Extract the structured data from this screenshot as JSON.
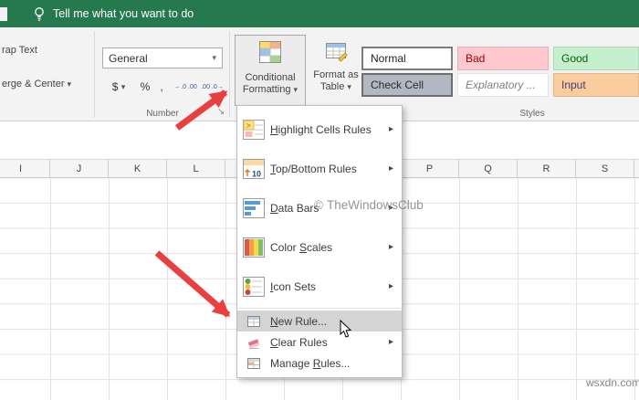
{
  "colors": {
    "brand-green": "#26794f",
    "bad-bg": "#ffc7ce",
    "bad-text": "#9c0006",
    "good-bg": "#c6efce",
    "good-text": "#006100",
    "input-bg": "#fbcd9e",
    "input-text": "#3f3f76",
    "check-bg": "#b2b8c2",
    "menu-highlight": "#d4d4d4",
    "arrow-red": "#e84040",
    "grid-line": "#e2e2e2"
  },
  "topbar": {
    "search_hint": "Tell me what you want to do"
  },
  "ribbon": {
    "wrap_text": "rap Text",
    "merge_center": "erge & Center",
    "number_format_value": "General",
    "currency": "$",
    "percent": "%",
    "comma": ",",
    "increase_decimal": "←.0 .00",
    "decrease_decimal": ".00 .0→",
    "number_group_label": "Number",
    "conditional_formatting_label": "Conditional Formatting",
    "format_as_table_label": "Format as Table",
    "styles_group_label": "Styles",
    "styles": [
      {
        "label": "Normal"
      },
      {
        "label": "Bad"
      },
      {
        "label": "Good"
      },
      {
        "label": "Check Cell"
      },
      {
        "label": "Explanatory ..."
      },
      {
        "label": "Input"
      }
    ]
  },
  "icons": {
    "caret_down": "▾",
    "submenu_arrow": "▸",
    "dialog_launcher": "↘"
  },
  "sheet": {
    "columns": [
      "I",
      "J",
      "K",
      "L",
      "",
      "",
      "",
      "P",
      "Q",
      "R",
      "S",
      ""
    ]
  },
  "menu": {
    "items": [
      {
        "pre": "",
        "key": "H",
        "post": "ighlight Cells Rules",
        "icon": "highlight-cells-rules-icon",
        "submenu": true,
        "highlighted": false
      },
      {
        "pre": "",
        "key": "T",
        "post": "op/Bottom Rules",
        "icon": "top-bottom-rules-icon",
        "submenu": true,
        "highlighted": false
      },
      {
        "pre": "",
        "key": "D",
        "post": "ata Bars",
        "icon": "data-bars-icon",
        "submenu": true,
        "highlighted": false
      },
      {
        "pre": "Color ",
        "key": "S",
        "post": "cales",
        "icon": "color-scales-icon",
        "submenu": true,
        "highlighted": false
      },
      {
        "pre": "",
        "key": "I",
        "post": "con Sets",
        "icon": "icon-sets-icon",
        "submenu": true,
        "highlighted": false
      },
      {
        "pre": "",
        "key": "N",
        "post": "ew Rule...",
        "icon": "new-rule-icon",
        "submenu": false,
        "highlighted": true
      },
      {
        "pre": "",
        "key": "C",
        "post": "lear Rules",
        "icon": "clear-rules-icon",
        "submenu": true,
        "highlighted": false
      },
      {
        "pre": "Manage ",
        "key": "R",
        "post": "ules...",
        "icon": "manage-rules-icon",
        "submenu": false,
        "highlighted": false
      }
    ]
  },
  "watermark": {
    "symbol": "©",
    "center": "TheWindowsClub",
    "corner": "wsxdn.com"
  }
}
